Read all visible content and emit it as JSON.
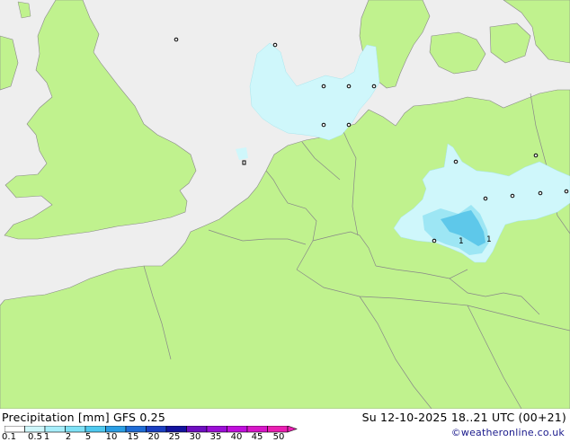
{
  "header": {
    "title": "Precipitation [mm]  GFS 0.25",
    "datetime": "Su 12-10-2025 18..21 UTC (00+21)",
    "credit": "©weatheronline.co.uk"
  },
  "colors": {
    "sea": "#eeeeee",
    "land": "#c0f28e",
    "border": "#888888",
    "precip_light": "#cff7fb",
    "precip_mid": "#9de6f4",
    "precip_heavy": "#5ec8ea"
  },
  "legend": {
    "ticks": [
      "0.1",
      "0.5",
      "1",
      "2",
      "5",
      "10",
      "15",
      "20",
      "25",
      "30",
      "35",
      "40",
      "45",
      "50"
    ],
    "colors": [
      "#ffffff",
      "#cff7fb",
      "#a7eefa",
      "#7fe1f6",
      "#4fc9ef",
      "#2a9ee4",
      "#1f6cd6",
      "#1b3fc2",
      "#14149e",
      "#6e0fc0",
      "#9b0fd6",
      "#c00fdc",
      "#d817c8",
      "#ea1fb2"
    ]
  },
  "map_labels": [
    {
      "text": "1",
      "lon": 7.8,
      "lat": 51.0
    },
    {
      "text": "1",
      "lon": 8.3,
      "lat": 51.0
    }
  ]
}
